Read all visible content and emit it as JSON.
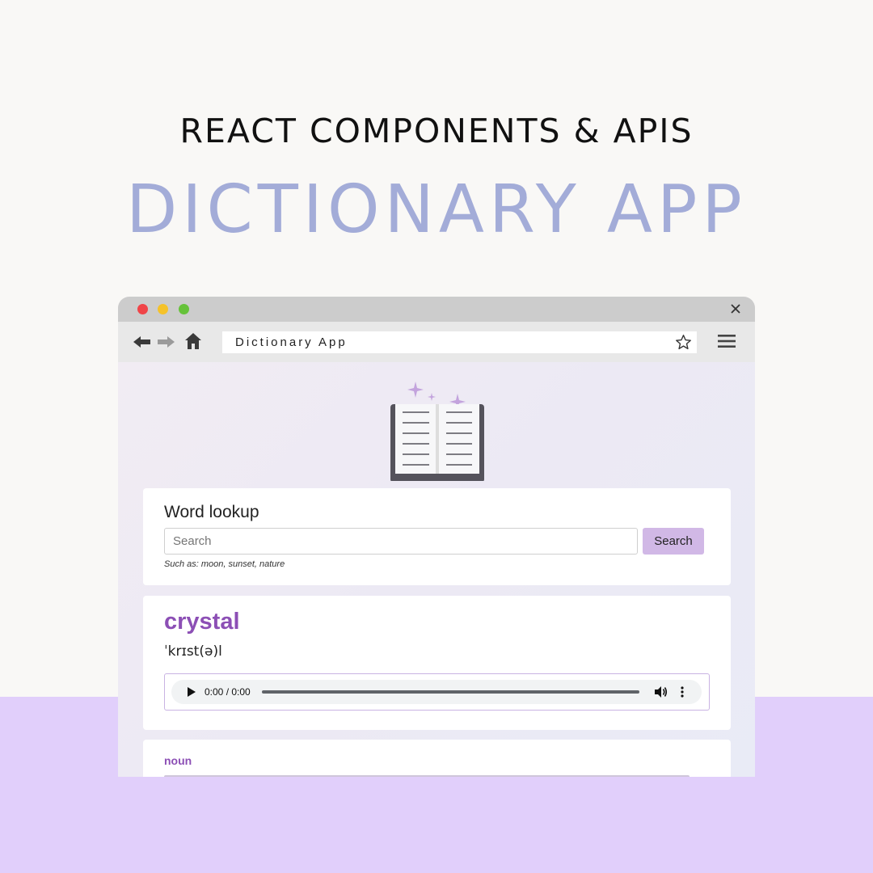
{
  "banner": {
    "subtitle": "REACT COMPONENTS & APIS",
    "title": "DICTIONARY APP"
  },
  "browser": {
    "url_text": "Dictionary App"
  },
  "lookup": {
    "heading": "Word lookup",
    "search_placeholder": "Search",
    "search_button": "Search",
    "hint": "Such as: moon, sunset, nature"
  },
  "result": {
    "word": "crystal",
    "phonetic": "ˈkrɪst(ə)l",
    "audio_time": "0:00 / 0:00"
  },
  "meaning": {
    "part_of_speech": "noun"
  },
  "colors": {
    "accent": "#8c4fb5",
    "title_blue": "#a3acd8",
    "band_lavender": "#e1cffb",
    "button": "#d1b8e6"
  },
  "icons": [
    "back-arrow-icon",
    "forward-arrow-icon",
    "home-icon",
    "star-icon",
    "hamburger-menu-icon",
    "close-icon",
    "open-book-icon",
    "sparkle-icon",
    "play-icon",
    "volume-icon",
    "more-vertical-icon"
  ]
}
